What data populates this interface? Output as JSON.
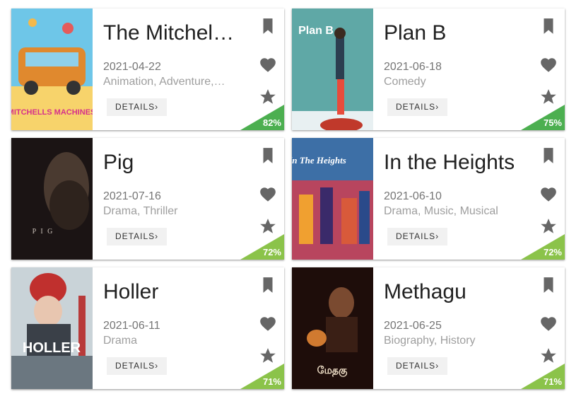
{
  "details_label": "DETAILS›",
  "movies": [
    {
      "title": "The Mitchell…",
      "date": "2021-04-22",
      "genres": "Animation, Adventure,…",
      "score": "82%",
      "score_color": "#4caf50"
    },
    {
      "title": "Plan B",
      "date": "2021-06-18",
      "genres": "Comedy",
      "score": "75%",
      "score_color": "#4caf50"
    },
    {
      "title": "Pig",
      "date": "2021-07-16",
      "genres": "Drama, Thriller",
      "score": "72%",
      "score_color": "#8bc34a"
    },
    {
      "title": "In the Heights",
      "date": "2021-06-10",
      "genres": "Drama, Music, Musical",
      "score": "72%",
      "score_color": "#8bc34a"
    },
    {
      "title": "Holler",
      "date": "2021-06-11",
      "genres": "Drama",
      "score": "71%",
      "score_color": "#8bc34a"
    },
    {
      "title": "Methagu",
      "date": "2021-06-25",
      "genres": "Biography, History",
      "score": "71%",
      "score_color": "#8bc34a"
    }
  ],
  "posters": {
    "mitchells_logo": "MITCHELLS MACHINES",
    "planb_logo": "Plan B",
    "pig_logo": "P I G",
    "heights_logo": "In The Heights",
    "holler_logo": "HOLLER",
    "methagu_logo": "மேதகு"
  },
  "icons": [
    "bookmark-icon",
    "heart-icon",
    "star-icon"
  ]
}
